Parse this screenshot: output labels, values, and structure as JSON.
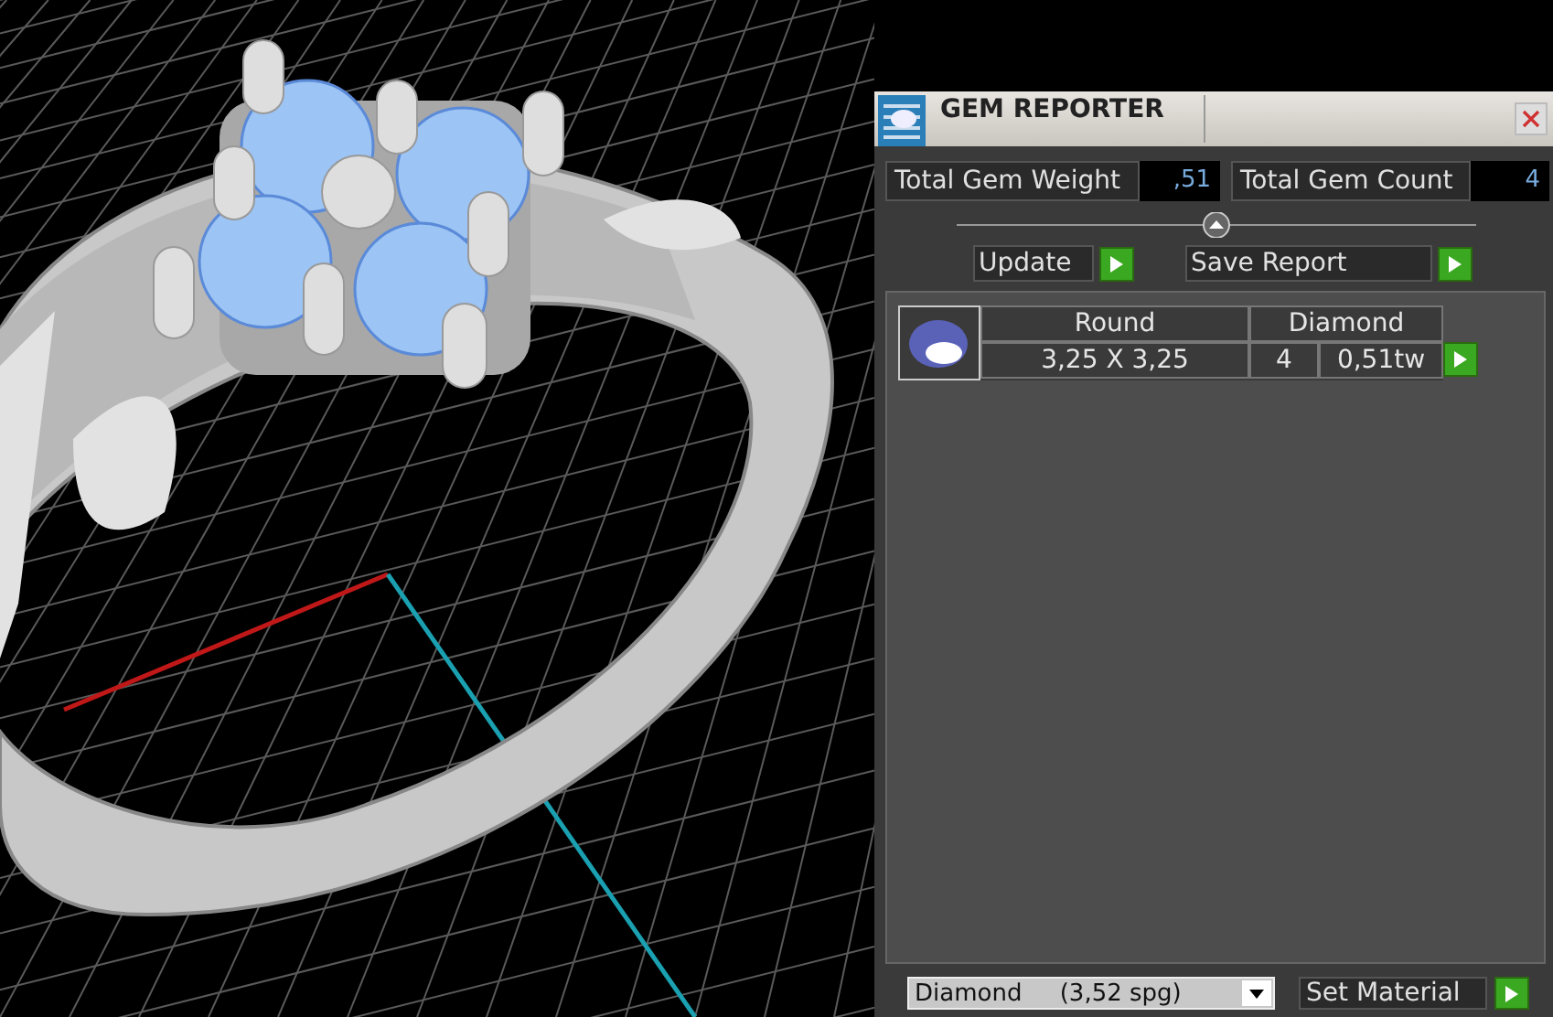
{
  "panel": {
    "title": "GEM REPORTER",
    "total_weight": {
      "label": "Total Gem Weight",
      "value": ",51"
    },
    "total_count": {
      "label": "Total Gem Count",
      "value": "4"
    },
    "buttons": [
      {
        "label": "Update"
      },
      {
        "label": "Save Report"
      }
    ],
    "gems": [
      {
        "shape": "Round",
        "material": "Diamond",
        "size": "3,25 X 3,25",
        "count": "4",
        "weight": "0,51tw"
      }
    ],
    "material_select": {
      "value": "Diamond     (3,52 spg)"
    },
    "set_material": {
      "label": "Set Material"
    }
  }
}
